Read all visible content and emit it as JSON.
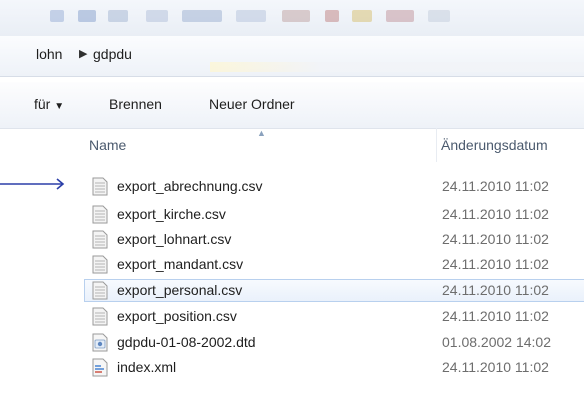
{
  "address": {
    "crumbs": [
      "lohn",
      "gdpdu"
    ]
  },
  "toolbar": {
    "organize_fragment": "für",
    "burn_label": "Brennen",
    "new_folder_label": "Neuer Ordner"
  },
  "columns": {
    "name": "Name",
    "date": "Änderungsdatum"
  },
  "files": [
    {
      "name": "export_abrechnung.csv",
      "date": "24.11.2010 11:02",
      "icon": "csv-file-icon"
    },
    {
      "name": "export_kirche.csv",
      "date": "24.11.2010 11:02",
      "icon": "csv-file-icon"
    },
    {
      "name": "export_lohnart.csv",
      "date": "24.11.2010 11:02",
      "icon": "csv-file-icon"
    },
    {
      "name": "export_mandant.csv",
      "date": "24.11.2010 11:02",
      "icon": "csv-file-icon"
    },
    {
      "name": "export_personal.csv",
      "date": "24.11.2010 11:02",
      "icon": "csv-file-icon",
      "selected": true
    },
    {
      "name": "export_position.csv",
      "date": "24.11.2010 11:02",
      "icon": "csv-file-icon"
    },
    {
      "name": "gdpdu-01-08-2002.dtd",
      "date": "01.08.2002 14:02",
      "icon": "dtd-file-icon"
    },
    {
      "name": "index.xml",
      "date": "24.11.2010 11:02",
      "icon": "xml-file-icon"
    }
  ],
  "colors": {
    "selection_border": "#b8d0ee",
    "annotation_arrow": "#2b3fa8"
  }
}
